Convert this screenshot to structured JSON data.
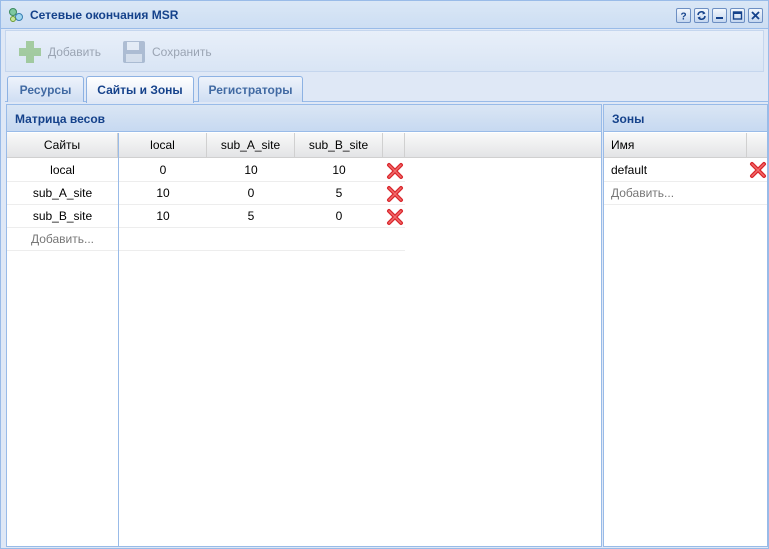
{
  "window": {
    "title": "Сетевые окончания MSR",
    "tools": [
      "help-icon",
      "refresh-icon",
      "minimize-icon",
      "maximize-icon",
      "close-icon"
    ]
  },
  "toolbar": {
    "add_label": "Добавить",
    "save_label": "Сохранить"
  },
  "tabs": [
    {
      "label": "Ресурсы",
      "active": false
    },
    {
      "label": "Сайты и Зоны",
      "active": true
    },
    {
      "label": "Регистраторы",
      "active": false
    }
  ],
  "matrix": {
    "title": "Матрица весов",
    "sites_header": "Сайты",
    "columns": [
      "local",
      "sub_A_site",
      "sub_B_site"
    ],
    "rows": [
      {
        "site": "local",
        "values": [
          "0",
          "10",
          "10"
        ]
      },
      {
        "site": "sub_A_site",
        "values": [
          "10",
          "0",
          "5"
        ]
      },
      {
        "site": "sub_B_site",
        "values": [
          "10",
          "5",
          "0"
        ]
      }
    ],
    "add_label": "Добавить..."
  },
  "zones": {
    "title": "Зоны",
    "name_header": "Имя",
    "items": [
      "default"
    ],
    "add_label": "Добавить..."
  },
  "colors": {
    "accent": "#15428b",
    "border": "#99bbe8",
    "delete": "#d9262c"
  }
}
